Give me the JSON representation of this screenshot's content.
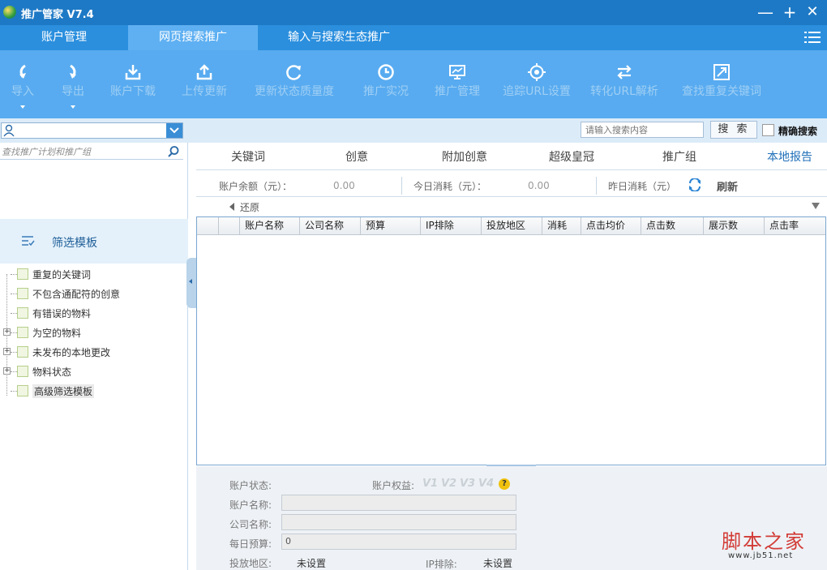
{
  "window": {
    "title": "推广管家 V7.4",
    "minimize": "—",
    "maximize": "+",
    "close": "✕"
  },
  "nav": {
    "tabs": [
      {
        "label": "账户管理"
      },
      {
        "label": "网页搜索推广",
        "active": true
      },
      {
        "label": "输入与搜索生态推广"
      }
    ]
  },
  "toolbar": {
    "items": [
      {
        "label": "导入",
        "icon": "import-icon",
        "dropdown": true
      },
      {
        "label": "导出",
        "icon": "export-icon",
        "dropdown": true
      },
      {
        "label": "账户下载",
        "icon": "download-icon"
      },
      {
        "label": "上传更新",
        "icon": "upload-icon"
      },
      {
        "label": "更新状态质量度",
        "icon": "refresh-icon"
      },
      {
        "label": "推广实况",
        "icon": "clock-icon"
      },
      {
        "label": "推广管理",
        "icon": "monitor-icon"
      },
      {
        "label": "追踪URL设置",
        "icon": "target-icon"
      },
      {
        "label": "转化URL解析",
        "icon": "swap-icon"
      },
      {
        "label": "查找重复关键词",
        "icon": "duplicate-icon"
      }
    ]
  },
  "search": {
    "placeholder": "请输入搜索内容",
    "button": "搜 索",
    "exact_label": "精确搜索"
  },
  "left": {
    "plan_search_placeholder": "查找推广计划和推广组",
    "filter_title": "筛选模板",
    "tree": [
      {
        "label": "重复的关键词",
        "expandable": false
      },
      {
        "label": "不包含通配符的创意",
        "expandable": false
      },
      {
        "label": "有错误的物料",
        "expandable": false
      },
      {
        "label": "为空的物料",
        "expandable": true
      },
      {
        "label": "未发布的本地更改",
        "expandable": true
      },
      {
        "label": "物料状态",
        "expandable": true
      },
      {
        "label": "高级筛选模板",
        "expandable": false,
        "selected": true
      }
    ]
  },
  "subtabs": {
    "items": [
      "关键词",
      "创意",
      "附加创意",
      "超级皇冠",
      "推广组"
    ],
    "local_report": "本地报告"
  },
  "balance": {
    "balance_label": "账户余额（元）：",
    "balance_value": "0.00",
    "today_label": "今日消耗（元）：",
    "today_value": "0.00",
    "yesterday_label": "昨日消耗（元）",
    "refresh_label": "刷新"
  },
  "grid": {
    "restore_label": "还原",
    "columns": [
      "",
      "",
      "账户名称",
      "公司名称",
      "预算",
      "IP排除",
      "投放地区",
      "消耗",
      "点击均价",
      "点击数",
      "展示数",
      "点击率"
    ]
  },
  "details": {
    "status_label": "账户状态:",
    "rights_label": "账户权益:",
    "v_badges": [
      "V1",
      "V2",
      "V3",
      "V4"
    ],
    "help": "?",
    "name_label": "账户名称:",
    "name_value": "",
    "company_label": "公司名称:",
    "company_value": "",
    "budget_label": "每日预算:",
    "budget_value": "0",
    "region_label": "投放地区:",
    "region_value": "未设置",
    "ip_label": "IP排除:",
    "ip_value": "未设置"
  },
  "watermark": {
    "text": "脚本之家",
    "url": "www.jb51.net"
  },
  "colors": {
    "titlebar": "#1d79c5",
    "navbar": "#2b8fde",
    "toolbar": "#58abf0",
    "active_tab": "#5fb0f2",
    "watermark": "#d23b36"
  }
}
